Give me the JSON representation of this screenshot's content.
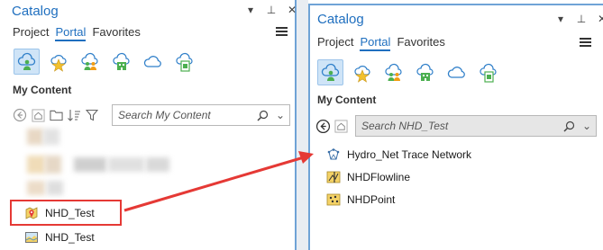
{
  "left": {
    "title": "Catalog",
    "tabs": [
      "Project",
      "Portal",
      "Favorites"
    ],
    "active_tab": "Portal",
    "section": "My Content",
    "search_placeholder": "Search My Content",
    "items": [
      {
        "label": "NHD_Test",
        "icon": "map-package-icon",
        "highlighted": true
      },
      {
        "label": "NHD_Test",
        "icon": "web-map-icon",
        "highlighted": false
      }
    ]
  },
  "right": {
    "title": "Catalog",
    "tabs": [
      "Project",
      "Portal",
      "Favorites"
    ],
    "active_tab": "Portal",
    "section": "My Content",
    "search_value": "Search NHD_Test",
    "items": [
      {
        "label": "Hydro_Net Trace Network",
        "icon": "trace-network-icon"
      },
      {
        "label": "NHDFlowline",
        "icon": "line-feature-class-icon"
      },
      {
        "label": "NHDPoint",
        "icon": "point-feature-class-icon"
      }
    ]
  },
  "colors": {
    "accent": "#1f6fbf",
    "highlight": "#e53935",
    "arrow": "#e53935",
    "pane_border": "#6fa3d6"
  },
  "portal_icons": [
    "my-content-icon",
    "favorites-icon",
    "my-groups-icon",
    "my-organization-icon",
    "arcgis-online-icon",
    "living-atlas-icon"
  ]
}
